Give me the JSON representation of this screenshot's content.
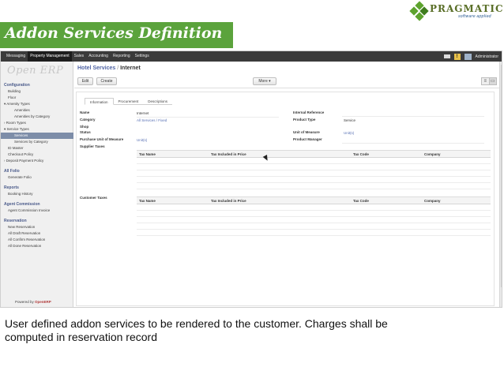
{
  "slide": {
    "logo_name": "PRAGMATIC",
    "logo_tagline": "software applied",
    "title": "Addon Services Definition",
    "caption_line1": "User defined addon services to be rendered to the customer. Charges shall be",
    "caption_line2": "computed in reservation record"
  },
  "topbar": {
    "menu": [
      "Messaging",
      "Property Management",
      "Sales",
      "Accounting",
      "Reporting",
      "Settings"
    ],
    "active_menu": "Property Management",
    "user": "Administrator"
  },
  "sidebar": {
    "logo": "Open ERP",
    "sections": [
      {
        "heading": "Configuration",
        "items": [
          {
            "label": "Building",
            "level": 1
          },
          {
            "label": "Floor",
            "level": 1
          },
          {
            "label": "Amenity Types",
            "level": 1,
            "expanded": true
          },
          {
            "label": "Amenities",
            "level": 2
          },
          {
            "label": "Amenities by Category",
            "level": 2
          },
          {
            "label": "Room Types",
            "level": 1,
            "collapsed": true
          },
          {
            "label": "Service Types",
            "level": 1,
            "expanded": true
          },
          {
            "label": "Services",
            "level": 2,
            "selected": true
          },
          {
            "label": "Services by Category",
            "level": 2
          },
          {
            "label": "ID Master",
            "level": 1
          },
          {
            "label": "Checkout Policy",
            "level": 1
          },
          {
            "label": "Deposit Payment Policy",
            "level": 1,
            "collapsed": true
          }
        ]
      },
      {
        "heading": "All Folio",
        "items": [
          {
            "label": "Generate Folio",
            "level": 1
          }
        ]
      },
      {
        "heading": "Reports",
        "items": [
          {
            "label": "Booking History",
            "level": 1
          }
        ]
      },
      {
        "heading": "Agent Commission",
        "items": [
          {
            "label": "Agent Commission Invoice",
            "level": 1
          }
        ]
      },
      {
        "heading": "Reservation",
        "items": [
          {
            "label": "New Reservation",
            "level": 1
          },
          {
            "label": "All Draft Reservation",
            "level": 1
          },
          {
            "label": "All Confirm Reservation",
            "level": 1
          },
          {
            "label": "All Done Reservation",
            "level": 1
          }
        ]
      }
    ],
    "powered_prefix": "Powered by ",
    "powered_brand": "OpenERP"
  },
  "content": {
    "breadcrumb_parent": "Hotel Services",
    "breadcrumb_sep": "/",
    "breadcrumb_current": "Internet",
    "edit_label": "Edit",
    "create_label": "Create",
    "more_label": "More ▾",
    "tabs": [
      "Information",
      "Procurement",
      "Descriptions"
    ],
    "active_tab": "Information",
    "left_fields": {
      "name_label": "Name",
      "name_value": "Internet",
      "category_label": "Category",
      "category_value": "All Services / Fixed",
      "shop_label": "Shop",
      "status_label": "Status",
      "puom_label": "Purchase Unit of Measure",
      "puom_value": "Unit(s)",
      "supplier_taxes_label": "Supplier Taxes",
      "customer_taxes_label": "Customer Taxes"
    },
    "right_fields": {
      "ref_label": "Internal Reference",
      "ptype_label": "Product Type",
      "ptype_value": "Service",
      "uom_label": "Unit of Measure",
      "uom_value": "Unit(s)",
      "pm_label": "Product Manager"
    },
    "tax_columns": [
      "Tax Name",
      "Tax Included in Price",
      "Tax Code",
      "Company"
    ]
  }
}
